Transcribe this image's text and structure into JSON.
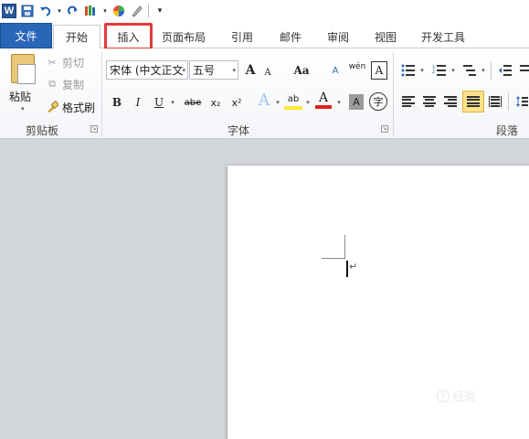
{
  "app": {
    "logo_letter": "W"
  },
  "qat": {
    "save_icon": "save-icon",
    "undo_icon": "undo-icon",
    "redo_icon": "redo-icon"
  },
  "tabs": [
    {
      "label": "文件"
    },
    {
      "label": "开始"
    },
    {
      "label": "插入"
    },
    {
      "label": "页面布局"
    },
    {
      "label": "引用"
    },
    {
      "label": "邮件"
    },
    {
      "label": "审阅"
    },
    {
      "label": "视图"
    },
    {
      "label": "开发工具"
    }
  ],
  "clipboard": {
    "paste_label": "粘贴",
    "cut_label": "剪切",
    "copy_label": "复制",
    "format_painter_label": "格式刷",
    "group_label": "剪贴板"
  },
  "font": {
    "font_name": "宋体 (中文正文",
    "font_size": "五号",
    "grow_label": "A",
    "shrink_label": "A",
    "case_label": "Aa",
    "clear_label": "A",
    "phonetic_label": "wén",
    "border_char_label": "A",
    "bold_label": "B",
    "italic_label": "I",
    "underline_label": "U",
    "strike_label": "abe",
    "subscript_label": "x₂",
    "superscript_label": "x²",
    "effects_label": "A",
    "highlight_label": "ab",
    "color_label": "A",
    "shading_label": "A",
    "enclose_label": "字",
    "group_label": "字体",
    "colors": {
      "font_color": "#e0201a",
      "highlight": "#ffe83a"
    }
  },
  "paragraph": {
    "group_label": "段落"
  },
  "watermark": {
    "badge": "S",
    "text": "经验"
  }
}
